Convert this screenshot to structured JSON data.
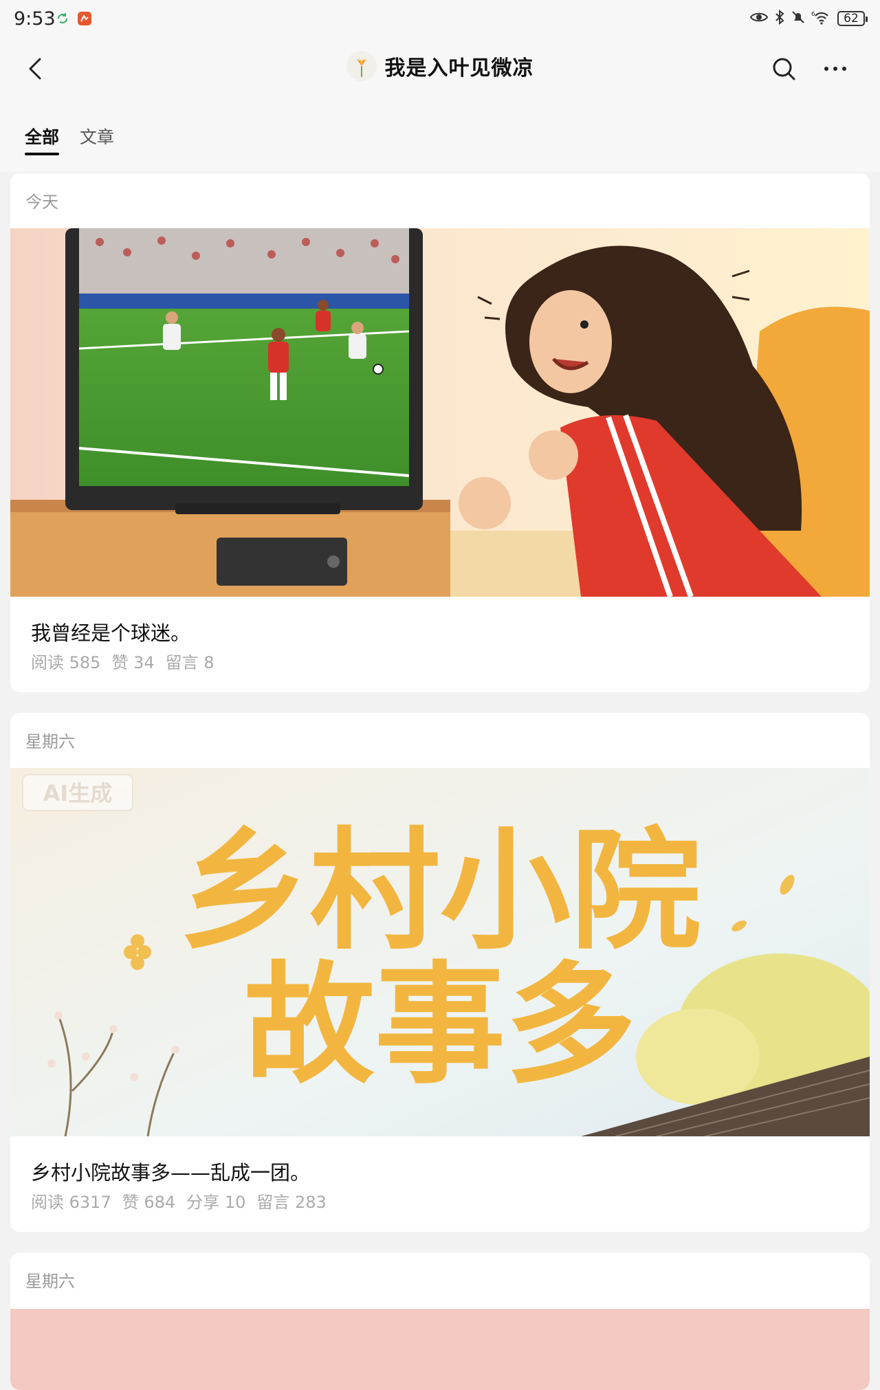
{
  "status_bar": {
    "time": "9:53",
    "battery": "62"
  },
  "header": {
    "title": "我是入叶见微凉"
  },
  "tabs": [
    {
      "label": "全部",
      "active": true
    },
    {
      "label": "文章",
      "active": false
    }
  ],
  "articles": [
    {
      "date": "今天",
      "title": "我曾经是个球迷。",
      "stats": [
        {
          "label": "阅读",
          "value": "585"
        },
        {
          "label": "赞",
          "value": "34"
        },
        {
          "label": "留言",
          "value": "8"
        }
      ]
    },
    {
      "date": "星期六",
      "title": "乡村小院故事多——乱成一团。",
      "image_text": {
        "watermark": "AI生成",
        "line1": "乡村小院",
        "line2": "故事多"
      },
      "stats": [
        {
          "label": "阅读",
          "value": "6317"
        },
        {
          "label": "赞",
          "value": "684"
        },
        {
          "label": "分享",
          "value": "10"
        },
        {
          "label": "留言",
          "value": "283"
        }
      ]
    },
    {
      "date": "星期六"
    }
  ],
  "colors": {
    "accent": "#111111",
    "meta": "#aaaaaa",
    "jersey": "#e03a2c",
    "title_art": "#f2b640"
  }
}
